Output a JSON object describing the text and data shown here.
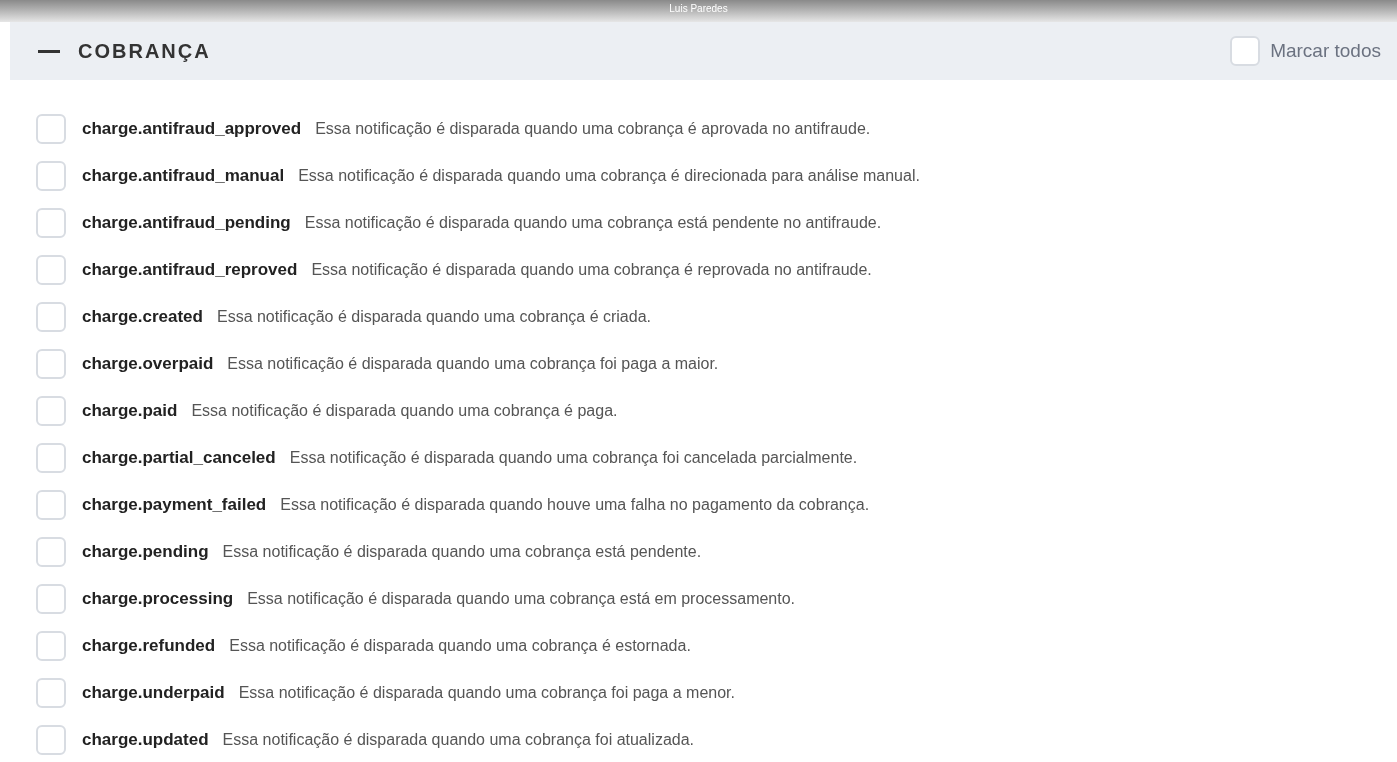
{
  "overlay": {
    "user_name": "Luis Paredes"
  },
  "section": {
    "title": "COBRANÇA",
    "expanded": true,
    "select_all": {
      "label": "Marcar todos",
      "checked": false
    }
  },
  "events": [
    {
      "name": "charge.antifraud_approved",
      "description": "Essa notificação é disparada quando uma cobrança é aprovada no antifraude.",
      "checked": false
    },
    {
      "name": "charge.antifraud_manual",
      "description": "Essa notificação é disparada quando uma cobrança é direcionada para análise manual.",
      "checked": false
    },
    {
      "name": "charge.antifraud_pending",
      "description": "Essa notificação é disparada quando uma cobrança está pendente no antifraude.",
      "checked": false
    },
    {
      "name": "charge.antifraud_reproved",
      "description": "Essa notificação é disparada quando uma cobrança é reprovada no antifraude.",
      "checked": false
    },
    {
      "name": "charge.created",
      "description": "Essa notificação é disparada quando uma cobrança é criada.",
      "checked": false
    },
    {
      "name": "charge.overpaid",
      "description": "Essa notificação é disparada quando uma cobrança foi paga a maior.",
      "checked": false
    },
    {
      "name": "charge.paid",
      "description": "Essa notificação é disparada quando uma cobrança é paga.",
      "checked": false
    },
    {
      "name": "charge.partial_canceled",
      "description": "Essa notificação é disparada quando uma cobrança foi cancelada parcialmente.",
      "checked": false
    },
    {
      "name": "charge.payment_failed",
      "description": "Essa notificação é disparada quando houve uma falha no pagamento da cobrança.",
      "checked": false
    },
    {
      "name": "charge.pending",
      "description": "Essa notificação é disparada quando uma cobrança está pendente.",
      "checked": false
    },
    {
      "name": "charge.processing",
      "description": "Essa notificação é disparada quando uma cobrança está em processamento.",
      "checked": false
    },
    {
      "name": "charge.refunded",
      "description": "Essa notificação é disparada quando uma cobrança é estornada.",
      "checked": false
    },
    {
      "name": "charge.underpaid",
      "description": "Essa notificação é disparada quando uma cobrança foi paga a menor.",
      "checked": false
    },
    {
      "name": "charge.updated",
      "description": "Essa notificação é disparada quando uma cobrança foi atualizada.",
      "checked": false
    }
  ]
}
